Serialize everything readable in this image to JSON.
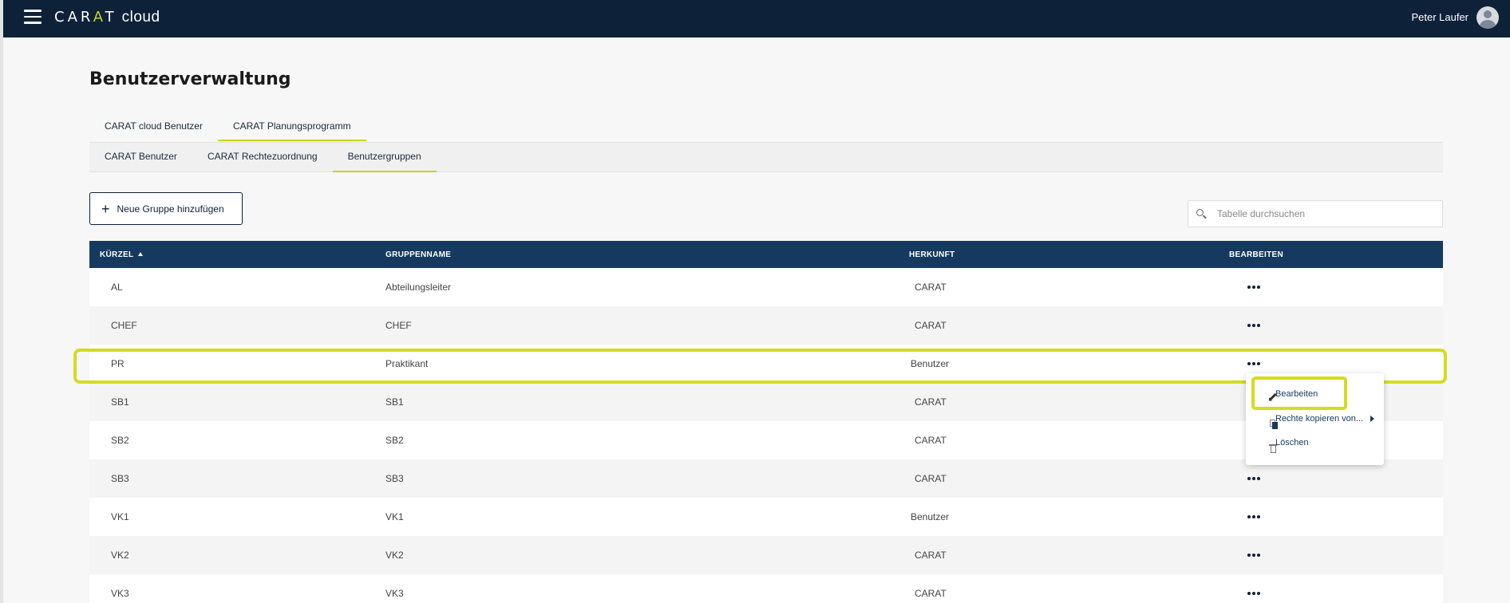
{
  "header": {
    "brand": "CARAT",
    "brand_suffix": "cloud",
    "user_name": "Peter Laufer"
  },
  "page": {
    "title": "Benutzerverwaltung"
  },
  "tabs_primary": [
    {
      "label": "CARAT cloud Benutzer",
      "active": false
    },
    {
      "label": "CARAT Planungsprogramm",
      "active": true
    }
  ],
  "tabs_secondary": [
    {
      "label": "CARAT Benutzer",
      "active": false
    },
    {
      "label": "CARAT Rechtezuordnung",
      "active": false
    },
    {
      "label": "Benutzergruppen",
      "active": true
    }
  ],
  "toolbar": {
    "add_label": "Neue Gruppe hinzufügen",
    "search_placeholder": "Tabelle durchsuchen"
  },
  "table": {
    "columns": [
      "KÜRZEL",
      "GRUPPENNAME",
      "HERKUNFT",
      "BEARBEITEN"
    ],
    "sort_column": "KÜRZEL",
    "sort_direction": "ascending",
    "rows": [
      {
        "kuerzel": "AL",
        "gruppenname": "Abteilungsleiter",
        "herkunft": "CARAT"
      },
      {
        "kuerzel": "CHEF",
        "gruppenname": "CHEF",
        "herkunft": "CARAT"
      },
      {
        "kuerzel": "PR",
        "gruppenname": "Praktikant",
        "herkunft": "Benutzer"
      },
      {
        "kuerzel": "SB1",
        "gruppenname": "SB1",
        "herkunft": "CARAT"
      },
      {
        "kuerzel": "SB2",
        "gruppenname": "SB2",
        "herkunft": "CARAT"
      },
      {
        "kuerzel": "SB3",
        "gruppenname": "SB3",
        "herkunft": "CARAT"
      },
      {
        "kuerzel": "VK1",
        "gruppenname": "VK1",
        "herkunft": "Benutzer"
      },
      {
        "kuerzel": "VK2",
        "gruppenname": "VK2",
        "herkunft": "CARAT"
      },
      {
        "kuerzel": "VK3",
        "gruppenname": "VK3",
        "herkunft": "CARAT"
      }
    ]
  },
  "context_menu": {
    "items": [
      {
        "label": "Bearbeiten",
        "icon": "pencil-icon"
      },
      {
        "label": "Rechte kopieren von...",
        "icon": "copy-icon",
        "has_submenu": true
      },
      {
        "label": "Löschen",
        "icon": "trash-icon"
      }
    ]
  },
  "colors": {
    "header_bg": "#0d2139",
    "table_header_bg": "#163a5f",
    "accent": "#c9d41a",
    "highlight": "#d4dc1e"
  }
}
